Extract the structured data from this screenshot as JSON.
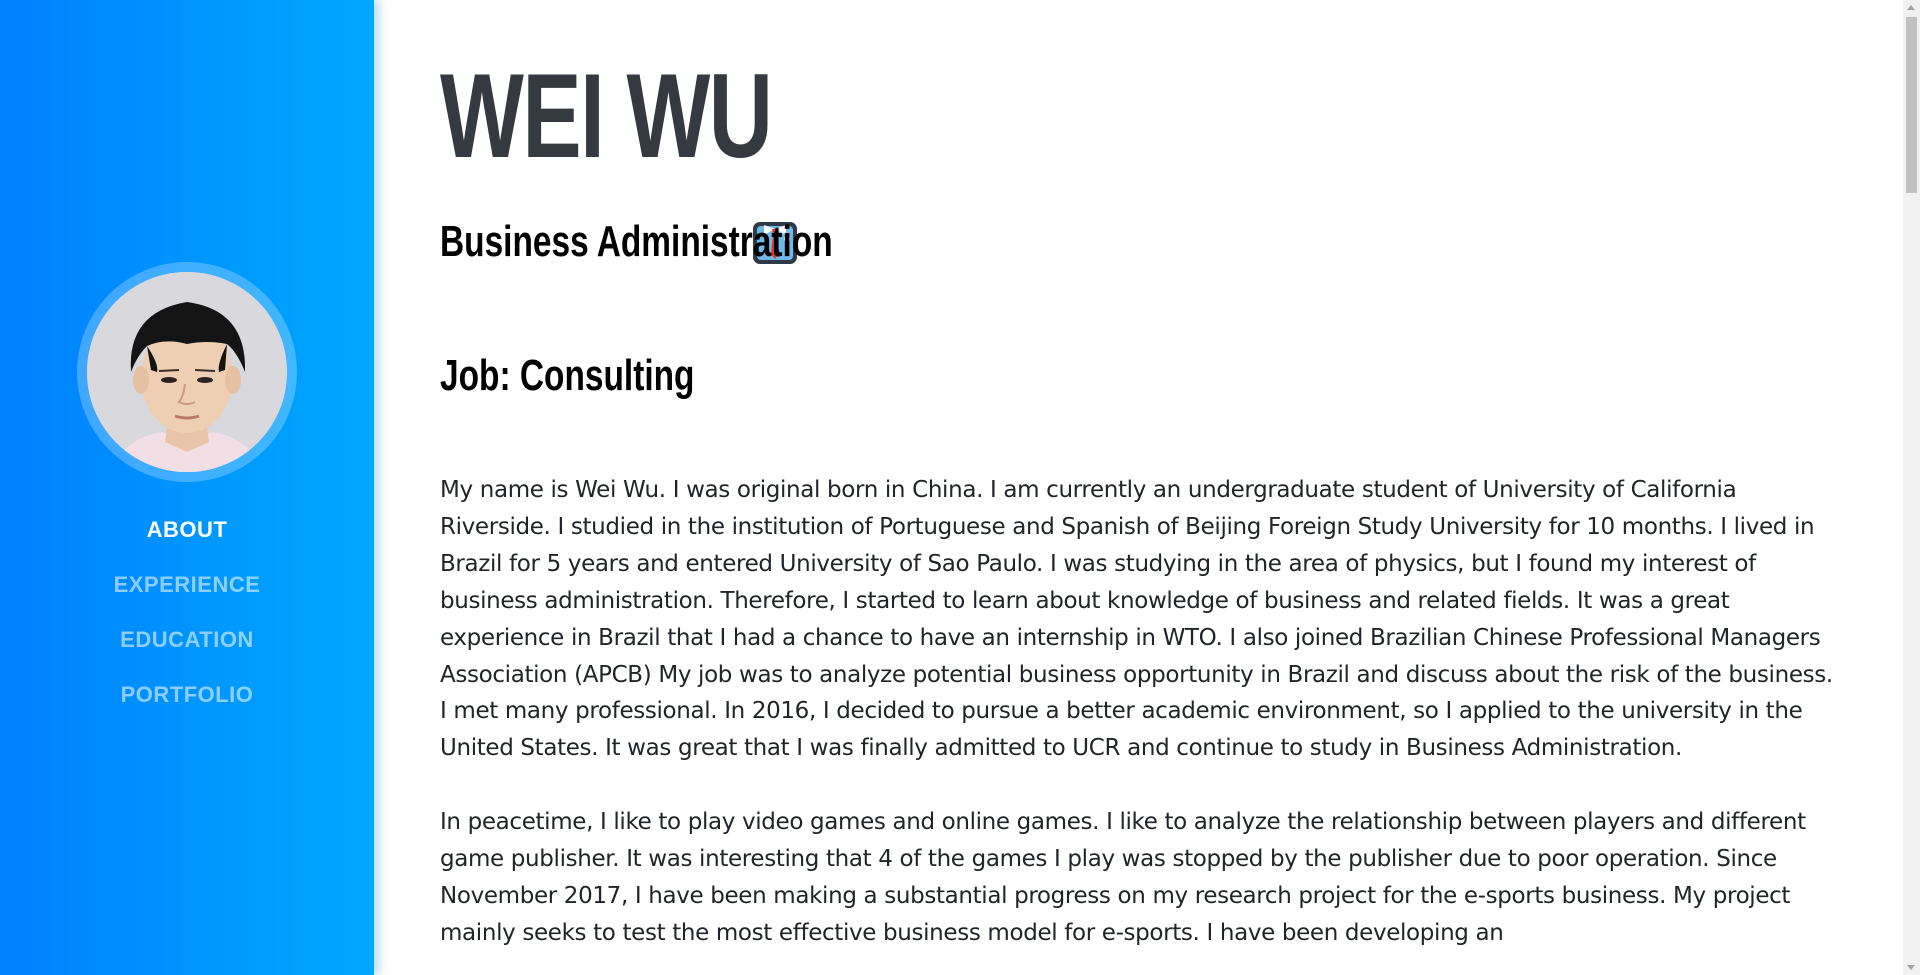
{
  "sidebar": {
    "nav_items": [
      {
        "label": "ABOUT",
        "active": true
      },
      {
        "label": "EXPERIENCE",
        "active": false
      },
      {
        "label": "EDUCATION",
        "active": false
      },
      {
        "label": "PORTFOLIO",
        "active": false
      }
    ],
    "gradient_start": "#0080ff",
    "gradient_end": "#00a8ff"
  },
  "main": {
    "name": "WEI WU",
    "subtitle": "Business Administration",
    "subtitle_icon": "necktie-shirt-icon",
    "job": "Job: Consulting",
    "paragraphs": [
      "My name is Wei Wu. I was original born in China. I am currently an undergraduate student of University of California Riverside. I studied in the institution of Portuguese and Spanish of Beijing Foreign Study University for 10 months. I lived in Brazil for 5 years and entered University of Sao Paulo. I was studying in the area of physics, but I found my interest of business administration. Therefore, I started to learn about knowledge of business and related fields. It was a great experience in Brazil that I had a chance to have an internship in WTO. I also joined Brazilian Chinese Professional Managers Association (APCB) My job was to analyze potential business opportunity in Brazil and discuss about the risk of the business. I met many professional. In 2016, I decided to pursue a better academic environment, so I applied to the university in the United States. It was great that I was finally admitted to UCR and continue to study in Business Administration.",
      "In peacetime, I like to play video games and online games. I like to analyze the relationship between players and different game publisher. It was interesting that 4 of the games I play was stopped by the publisher due to poor operation. Since November 2017, I have been making a substantial progress on my research project for the e-sports business. My project mainly seeks to test the most effective business model for e-sports. I have been developing an"
    ]
  }
}
